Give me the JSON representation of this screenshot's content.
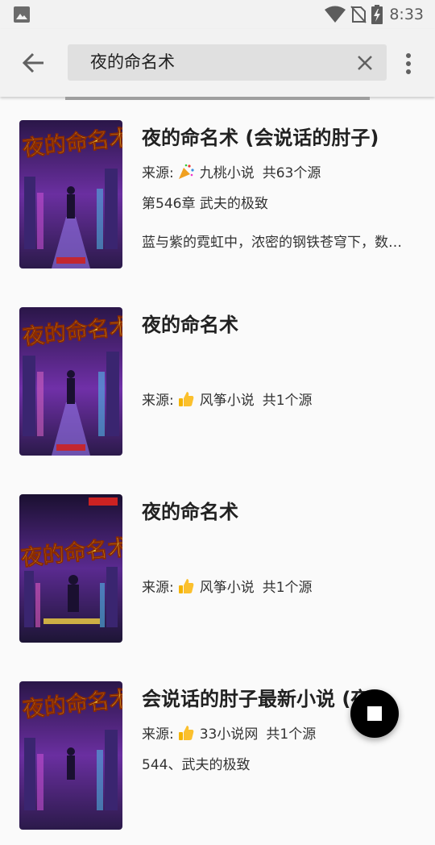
{
  "status_bar": {
    "time": "8:33"
  },
  "toolbar": {
    "search_value": "夜的命名术"
  },
  "results": [
    {
      "title": "夜的命名术 (会说话的肘子)",
      "source_prefix": "来源:",
      "source_icon": "party-popper-icon",
      "source_name": "九桃小说",
      "source_count": "共63个源",
      "latest": "第546章 武夫的极致",
      "intro": "蓝与紫的霓虹中，浓密的钢铁苍穹下，数条巨大的..."
    },
    {
      "title": "夜的命名术",
      "source_prefix": "来源:",
      "source_icon": "thumbs-up-icon",
      "source_name": "风筝小说",
      "source_count": "共1个源",
      "latest": "",
      "intro": ""
    },
    {
      "title": "夜的命名术",
      "source_prefix": "来源:",
      "source_icon": "thumbs-up-icon",
      "source_name": "风筝小说",
      "source_count": "共1个源",
      "latest": "",
      "intro": ""
    },
    {
      "title": "会说话的肘子最新小说 (夜的命名术)",
      "source_prefix": "来源:",
      "source_icon": "thumbs-up-icon",
      "source_name": "33小说网",
      "source_count": "共1个源",
      "latest": "544、武夫的极致",
      "intro": ""
    }
  ],
  "colors": {
    "accent": "#000000",
    "cover_purple": "#6a2fa0",
    "cover_gold": "#f5d442"
  }
}
